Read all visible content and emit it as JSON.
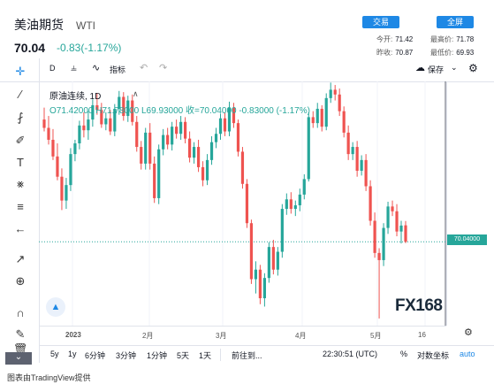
{
  "header": {
    "title": "美油期货",
    "symbol": "WTI",
    "price": "70.04",
    "change": "-0.83(-1.17%)",
    "trade_button": "交易",
    "fullscreen_button": "全屏",
    "stats": {
      "open_label": "今开:",
      "open": "71.42",
      "high_label": "最高价:",
      "high": "71.78",
      "prev_close_label": "昨收:",
      "prev_close": "70.87",
      "low_label": "最低价:",
      "low": "69.93"
    }
  },
  "toolbar": {
    "interval": "D",
    "indicators_label": "指标",
    "save_label": "保存"
  },
  "legend": {
    "name": "原油连续, 1D",
    "ohlc": "O71.42000  H71.78000  L69.93000  收=70.04000  -0.83000  (-1.17%)"
  },
  "bottombar": {
    "ranges": [
      "5y",
      "1y",
      "6分钟",
      "3分钟",
      "1分钟",
      "5天",
      "1天"
    ],
    "goto": "前往到...",
    "clock": "22:30:51 (UTC)",
    "percent": "%",
    "log_label": "对数坐标",
    "auto_label": "auto"
  },
  "footer": "图表由TradingView提供",
  "watermark": "FX168",
  "colors": {
    "up": "#26a69a",
    "down": "#ef5350",
    "accent": "#1e88e5"
  },
  "chart_data": {
    "type": "candlestick",
    "title": "原油连续, 1D",
    "x_tick_labels": [
      "2023",
      "2月",
      "3月",
      "4月",
      "5月",
      "16"
    ],
    "last_price_label": "70.04000",
    "ylim": [
      63,
      83.5
    ],
    "candles": [
      {
        "o": 80.3,
        "h": 81.3,
        "l": 79.3,
        "c": 79.6
      },
      {
        "o": 79.6,
        "h": 80.6,
        "l": 78.2,
        "c": 78.6
      },
      {
        "o": 78.6,
        "h": 79.5,
        "l": 76.9,
        "c": 77.2
      },
      {
        "o": 77.2,
        "h": 78.3,
        "l": 75.2,
        "c": 75.5
      },
      {
        "o": 75.5,
        "h": 76.2,
        "l": 72.7,
        "c": 73.5
      },
      {
        "o": 73.5,
        "h": 75.4,
        "l": 72.8,
        "c": 74.8
      },
      {
        "o": 74.8,
        "h": 77.9,
        "l": 74.3,
        "c": 77.4
      },
      {
        "o": 77.4,
        "h": 78.6,
        "l": 76.8,
        "c": 78.3
      },
      {
        "o": 78.3,
        "h": 80.2,
        "l": 77.8,
        "c": 79.8
      },
      {
        "o": 79.8,
        "h": 80.9,
        "l": 78.8,
        "c": 79.4
      },
      {
        "o": 79.4,
        "h": 81.0,
        "l": 78.6,
        "c": 80.3
      },
      {
        "o": 80.3,
        "h": 82.0,
        "l": 79.7,
        "c": 81.5
      },
      {
        "o": 81.5,
        "h": 82.5,
        "l": 80.7,
        "c": 81.1
      },
      {
        "o": 81.1,
        "h": 81.7,
        "l": 79.6,
        "c": 79.9
      },
      {
        "o": 79.9,
        "h": 80.9,
        "l": 79.4,
        "c": 80.4
      },
      {
        "o": 80.4,
        "h": 81.1,
        "l": 79.0,
        "c": 79.3
      },
      {
        "o": 79.3,
        "h": 81.6,
        "l": 78.9,
        "c": 81.2
      },
      {
        "o": 81.2,
        "h": 82.7,
        "l": 80.7,
        "c": 82.2
      },
      {
        "o": 82.2,
        "h": 82.6,
        "l": 80.2,
        "c": 80.6
      },
      {
        "o": 80.6,
        "h": 82.3,
        "l": 80.1,
        "c": 81.9
      },
      {
        "o": 81.9,
        "h": 82.4,
        "l": 79.8,
        "c": 80.1
      },
      {
        "o": 80.1,
        "h": 80.6,
        "l": 77.6,
        "c": 78.0
      },
      {
        "o": 78.0,
        "h": 78.5,
        "l": 76.1,
        "c": 76.6
      },
      {
        "o": 76.6,
        "h": 79.6,
        "l": 76.1,
        "c": 79.2
      },
      {
        "o": 79.2,
        "h": 80.0,
        "l": 76.1,
        "c": 76.6
      },
      {
        "o": 76.6,
        "h": 77.2,
        "l": 73.3,
        "c": 73.7
      },
      {
        "o": 73.7,
        "h": 78.2,
        "l": 73.2,
        "c": 77.8
      },
      {
        "o": 77.8,
        "h": 79.5,
        "l": 77.3,
        "c": 79.0
      },
      {
        "o": 79.0,
        "h": 79.6,
        "l": 77.8,
        "c": 78.2
      },
      {
        "o": 78.2,
        "h": 80.1,
        "l": 77.7,
        "c": 79.7
      },
      {
        "o": 79.7,
        "h": 80.3,
        "l": 78.7,
        "c": 79.1
      },
      {
        "o": 79.1,
        "h": 80.6,
        "l": 78.6,
        "c": 80.1
      },
      {
        "o": 80.1,
        "h": 80.5,
        "l": 78.3,
        "c": 78.7
      },
      {
        "o": 78.7,
        "h": 79.3,
        "l": 76.7,
        "c": 77.1
      },
      {
        "o": 77.1,
        "h": 78.4,
        "l": 76.6,
        "c": 78.0
      },
      {
        "o": 78.0,
        "h": 78.6,
        "l": 75.9,
        "c": 76.3
      },
      {
        "o": 76.3,
        "h": 76.8,
        "l": 74.7,
        "c": 75.2
      },
      {
        "o": 75.2,
        "h": 77.4,
        "l": 74.8,
        "c": 76.9
      },
      {
        "o": 76.9,
        "h": 78.9,
        "l": 76.5,
        "c": 78.4
      },
      {
        "o": 78.4,
        "h": 79.6,
        "l": 77.9,
        "c": 79.1
      },
      {
        "o": 79.1,
        "h": 80.8,
        "l": 78.6,
        "c": 80.4
      },
      {
        "o": 80.4,
        "h": 80.9,
        "l": 78.9,
        "c": 79.3
      },
      {
        "o": 79.3,
        "h": 81.8,
        "l": 78.9,
        "c": 81.3
      },
      {
        "o": 81.3,
        "h": 81.7,
        "l": 79.6,
        "c": 80.0
      },
      {
        "o": 80.0,
        "h": 80.3,
        "l": 77.2,
        "c": 77.6
      },
      {
        "o": 77.6,
        "h": 78.0,
        "l": 74.5,
        "c": 74.9
      },
      {
        "o": 74.9,
        "h": 75.3,
        "l": 71.2,
        "c": 71.6
      },
      {
        "o": 71.6,
        "h": 71.9,
        "l": 66.5,
        "c": 66.9
      },
      {
        "o": 66.9,
        "h": 68.4,
        "l": 65.7,
        "c": 67.7
      },
      {
        "o": 67.7,
        "h": 68.1,
        "l": 64.8,
        "c": 65.3
      },
      {
        "o": 65.3,
        "h": 67.4,
        "l": 64.6,
        "c": 67.0
      },
      {
        "o": 67.0,
        "h": 70.0,
        "l": 66.6,
        "c": 69.6
      },
      {
        "o": 69.6,
        "h": 70.2,
        "l": 67.3,
        "c": 67.7
      },
      {
        "o": 67.7,
        "h": 69.6,
        "l": 67.2,
        "c": 69.2
      },
      {
        "o": 69.2,
        "h": 73.2,
        "l": 68.7,
        "c": 72.8
      },
      {
        "o": 72.8,
        "h": 74.1,
        "l": 72.3,
        "c": 73.6
      },
      {
        "o": 73.6,
        "h": 74.2,
        "l": 72.4,
        "c": 72.8
      },
      {
        "o": 72.8,
        "h": 73.5,
        "l": 72.2,
        "c": 73.1
      },
      {
        "o": 73.1,
        "h": 74.5,
        "l": 72.6,
        "c": 74.0
      },
      {
        "o": 74.0,
        "h": 75.7,
        "l": 73.6,
        "c": 75.3
      },
      {
        "o": 75.3,
        "h": 80.9,
        "l": 75.1,
        "c": 80.5
      },
      {
        "o": 80.5,
        "h": 81.0,
        "l": 79.6,
        "c": 80.0
      },
      {
        "o": 80.0,
        "h": 81.7,
        "l": 79.6,
        "c": 81.2
      },
      {
        "o": 81.2,
        "h": 81.5,
        "l": 79.3,
        "c": 79.7
      },
      {
        "o": 79.7,
        "h": 82.5,
        "l": 79.4,
        "c": 82.1
      },
      {
        "o": 82.1,
        "h": 83.4,
        "l": 81.7,
        "c": 82.8
      },
      {
        "o": 82.8,
        "h": 83.2,
        "l": 81.9,
        "c": 82.4
      },
      {
        "o": 82.4,
        "h": 82.9,
        "l": 80.6,
        "c": 81.0
      },
      {
        "o": 81.0,
        "h": 81.4,
        "l": 78.8,
        "c": 79.2
      },
      {
        "o": 79.2,
        "h": 79.8,
        "l": 76.9,
        "c": 77.4
      },
      {
        "o": 77.4,
        "h": 78.4,
        "l": 76.9,
        "c": 78.0
      },
      {
        "o": 78.0,
        "h": 78.5,
        "l": 75.5,
        "c": 76.0
      },
      {
        "o": 76.0,
        "h": 77.3,
        "l": 75.6,
        "c": 76.9
      },
      {
        "o": 76.9,
        "h": 77.4,
        "l": 74.3,
        "c": 74.7
      },
      {
        "o": 74.7,
        "h": 75.2,
        "l": 71.4,
        "c": 71.8
      },
      {
        "o": 71.8,
        "h": 72.5,
        "l": 68.7,
        "c": 69.1
      },
      {
        "o": 69.1,
        "h": 69.5,
        "l": 63.6,
        "c": 68.5
      },
      {
        "o": 68.5,
        "h": 71.6,
        "l": 68.0,
        "c": 71.2
      },
      {
        "o": 71.2,
        "h": 73.4,
        "l": 70.7,
        "c": 73.0
      },
      {
        "o": 73.0,
        "h": 73.5,
        "l": 72.2,
        "c": 72.6
      },
      {
        "o": 72.6,
        "h": 73.2,
        "l": 70.5,
        "c": 70.9
      },
      {
        "o": 70.9,
        "h": 71.8,
        "l": 69.9,
        "c": 71.4
      },
      {
        "o": 71.42,
        "h": 71.78,
        "l": 69.93,
        "c": 70.04
      }
    ]
  }
}
